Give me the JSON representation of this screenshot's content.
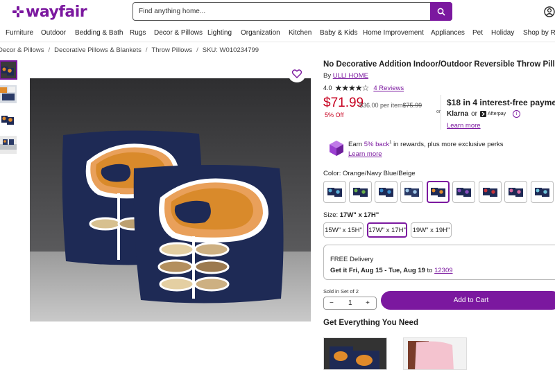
{
  "header": {
    "logo": "wayfair",
    "search_placeholder": "Find anything home...",
    "icons": [
      "wayfair-logo-icon",
      "search-icon",
      "account-icon"
    ]
  },
  "nav": [
    "Furniture",
    "Outdoor",
    "Bedding & Bath",
    "Rugs",
    "Decor & Pillows",
    "Lighting",
    "Organization",
    "Kitchen",
    "Baby & Kids",
    "Home Improvement",
    "Appliances",
    "Pet",
    "Holiday",
    "Shop by Ro"
  ],
  "breadcrumb": {
    "items": [
      "Decor & Pillows",
      "Decorative Pillows & Blankets",
      "Throw Pillows"
    ],
    "sep": "/",
    "sku": "SKU: W010234799"
  },
  "product": {
    "title": "No Decorative Addition Indoor/Outdoor Reversible Throw Pillow",
    "by": "By",
    "brand": "ULLI HOME",
    "rating": "4.0",
    "reviews": "4 Reviews",
    "price": "$71.99",
    "per_item": "$36.00 per item",
    "was_price": "$75.99",
    "discount": "5% Off",
    "or": "or",
    "klarna_line1": "$18 in 4 interest-free payments",
    "klarna": "Klarna",
    "klarna_or": "or",
    "afterpay": "Afterpay",
    "learn_more": "Learn more",
    "rewards_pre": "Earn ",
    "rewards_pct": "5% back",
    "rewards_sup": "1",
    "rewards_post": " in rewards, plus more exclusive perks",
    "rewards_learn": "Learn more",
    "color_label": "Color:",
    "color_value": "Orange/Navy Blue/Beige",
    "size_label": "Size:",
    "size_value": "17W\" x 17H\"",
    "sizes": [
      "15W\" x 15H\"",
      "17W\" x 17H\"",
      "19W\" x 19H\""
    ],
    "delivery_title": "FREE Delivery",
    "delivery_date": "Get it Fri, Aug 15 - Tue, Aug 19",
    "delivery_to": "to",
    "zip": "12309",
    "sold_in": "Sold in Set of 2",
    "qty": "1",
    "qty_minus": "−",
    "qty_plus": "+",
    "add_to_cart": "Add to Cart",
    "get_everything": "Get Everything You Need"
  },
  "colors": {
    "brand": "#7b189f",
    "sale": "#c7001f"
  }
}
